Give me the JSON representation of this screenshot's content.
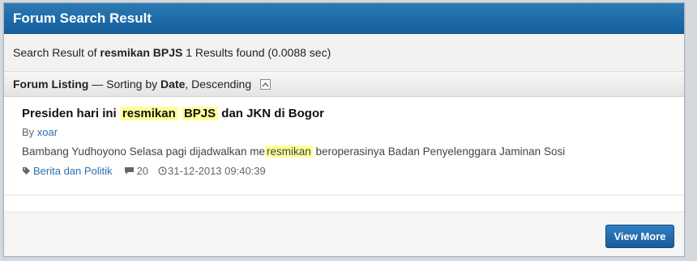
{
  "panel": {
    "title": "Forum Search Result"
  },
  "summary": {
    "prefix": "Search Result of",
    "term": "resmikan BPJS",
    "count_text": "1 Results found (0.0088 sec)"
  },
  "listing": {
    "label": "Forum Listing",
    "sort_sep": "— Sorting by",
    "sort_field": "Date",
    "sort_order": ", Descending",
    "toggle_icon": "chevron-up-icon"
  },
  "results": [
    {
      "title_pre": "Presiden hari ini",
      "title_hl1": "resmikan",
      "title_hl2": "BPJS",
      "title_post": "dan JKN di Bogor",
      "by_label": "By",
      "author": "xoar",
      "snippet_pre": "Bambang Yudhoyono Selasa pagi dijadwalkan me",
      "snippet_hl": "resmikan",
      "snippet_post": "beroperasinya Badan Penyelenggara Jaminan Sosi",
      "category": "Berita dan Politik",
      "replies": "20",
      "date": "31-12-2013 09:40:39"
    }
  ],
  "footer": {
    "view_more": "View More"
  },
  "colors": {
    "header": "#1f6aa8",
    "highlight": "#ffff99",
    "link": "#2a6fb0"
  }
}
